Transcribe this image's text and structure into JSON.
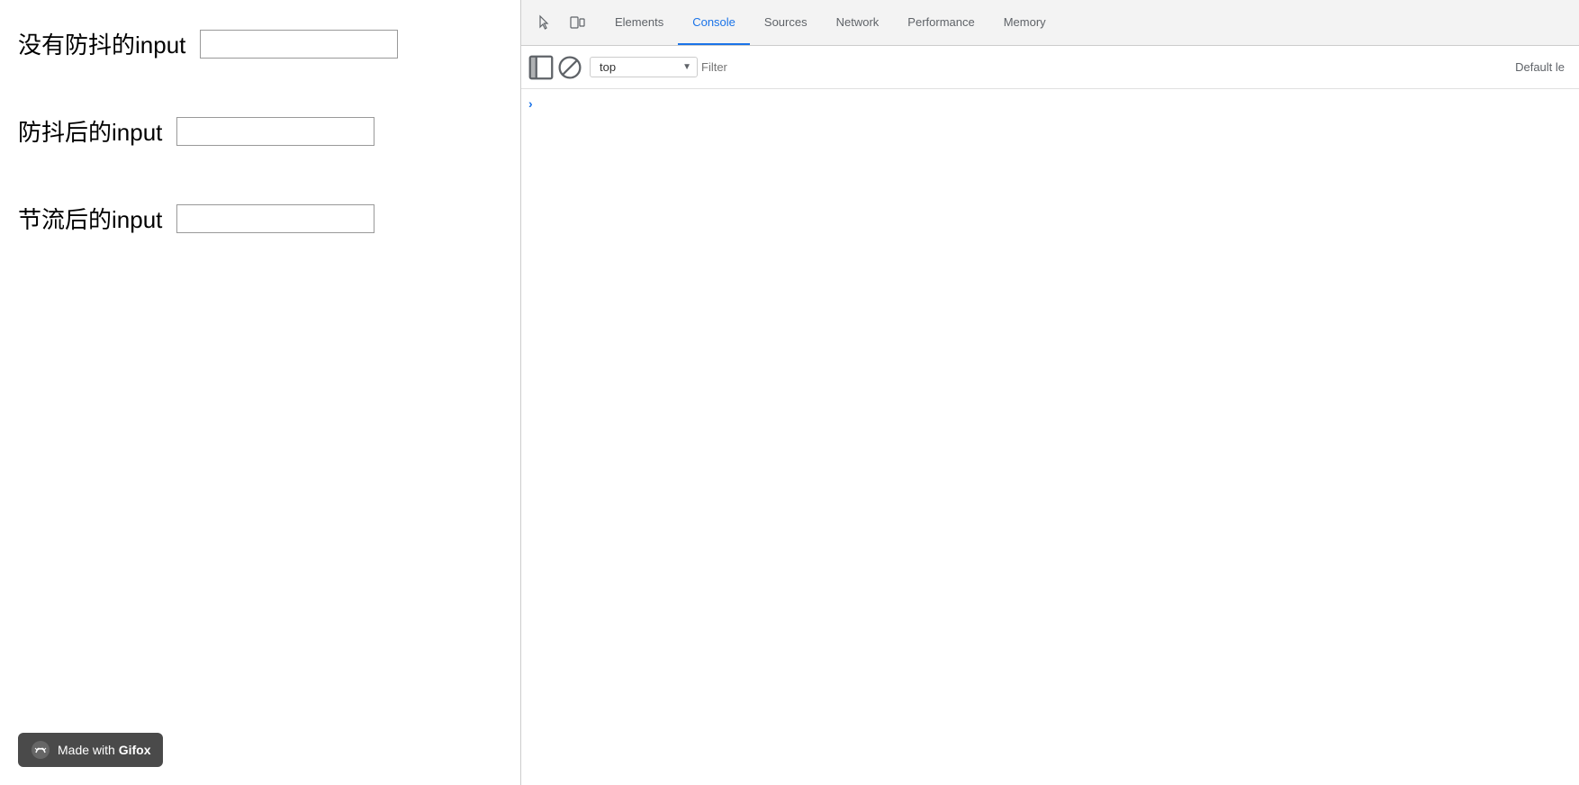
{
  "main_page": {
    "inputs": [
      {
        "label": "没有防抖的input",
        "id": "no-debounce"
      },
      {
        "label": "防抖后的input",
        "id": "debounce"
      },
      {
        "label": "节流后的input",
        "id": "throttle"
      }
    ],
    "badge": {
      "text_normal": "Made with ",
      "text_bold": "Gifox"
    }
  },
  "devtools": {
    "tabs": [
      {
        "label": "Elements",
        "active": false
      },
      {
        "label": "Console",
        "active": true
      },
      {
        "label": "Sources",
        "active": false
      },
      {
        "label": "Network",
        "active": false
      },
      {
        "label": "Performance",
        "active": false
      },
      {
        "label": "Memory",
        "active": false
      }
    ],
    "toolbar2": {
      "context": "top",
      "filter_placeholder": "Filter",
      "default_levels": "Default le"
    },
    "console_prompt": ">"
  }
}
